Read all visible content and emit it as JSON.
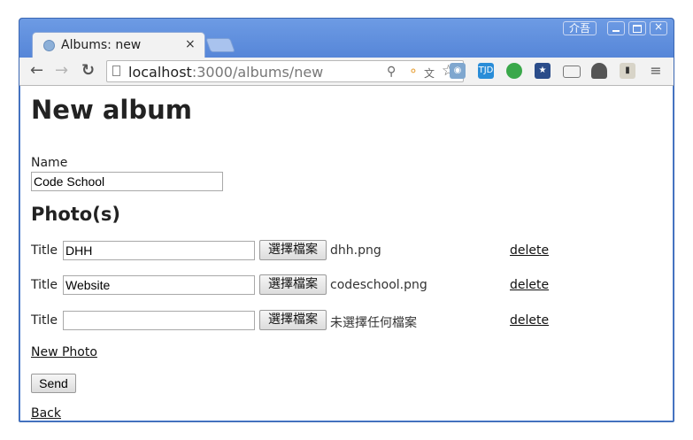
{
  "browser": {
    "user_badge": "介吾",
    "tab_title": "Albums: new",
    "tab_close": "×",
    "url_host": "localhost",
    "url_path": ":3000/albums/new",
    "window_close": "×"
  },
  "page": {
    "heading": "New album",
    "name_label": "Name",
    "name_value": "Code School",
    "photos_heading": "Photo(s)",
    "photos": [
      {
        "title_label": "Title",
        "title_value": "DHH",
        "choose_label": "選擇檔案",
        "file_name": "dhh.png",
        "delete_label": "delete"
      },
      {
        "title_label": "Title",
        "title_value": "Website",
        "choose_label": "選擇檔案",
        "file_name": "codeschool.png",
        "delete_label": "delete"
      },
      {
        "title_label": "Title",
        "title_value": "",
        "choose_label": "選擇檔案",
        "file_name": "未選擇任何檔案",
        "delete_label": "delete"
      }
    ],
    "new_photo_label": "New Photo",
    "send_label": "Send",
    "back_label": "Back"
  },
  "colors": {
    "window_frame": "#4f7fce",
    "toolbar_bg": "#f2f2f2"
  }
}
